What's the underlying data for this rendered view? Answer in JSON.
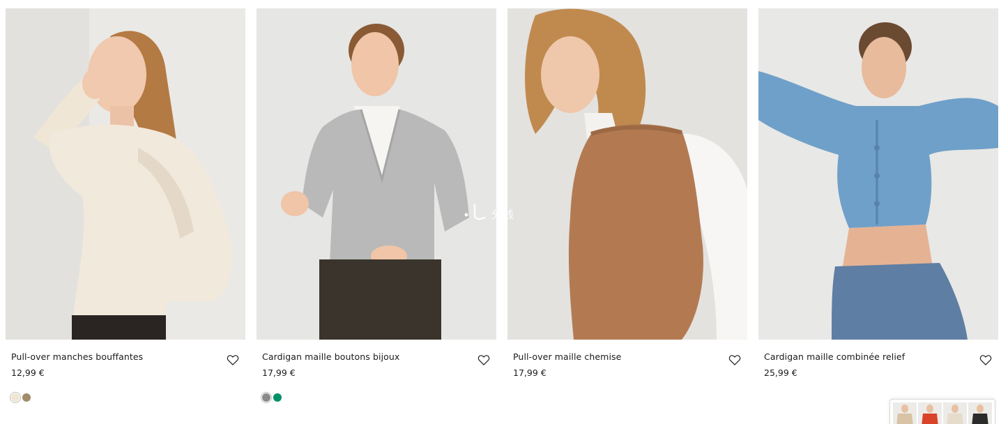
{
  "products": [
    {
      "title": "Pull-over manches bouffantes",
      "price": "12,99 €",
      "image_alt": "Pull-over manches bouffantes",
      "swatches": [
        {
          "color": "#efe6d4",
          "selected": true
        },
        {
          "color": "#a38b6a",
          "selected": false
        }
      ]
    },
    {
      "title": "Cardigan maille boutons bijoux",
      "price": "17,99 €",
      "image_alt": "Cardigan maille boutons bijoux",
      "swatches": [
        {
          "color": "#8a8a8a",
          "selected": true
        },
        {
          "color": "#00906a",
          "selected": false
        }
      ]
    },
    {
      "title": "Pull-over maille chemise",
      "price": "17,99 €",
      "image_alt": "Pull-over maille chemise",
      "swatches": []
    },
    {
      "title": "Cardigan maille combinée relief",
      "price": "25,99 €",
      "image_alt": "Cardigan maille combinée relief",
      "swatches": []
    }
  ],
  "watermark_text": "分钱",
  "icons": {
    "favorite": "heart-outline-icon"
  }
}
